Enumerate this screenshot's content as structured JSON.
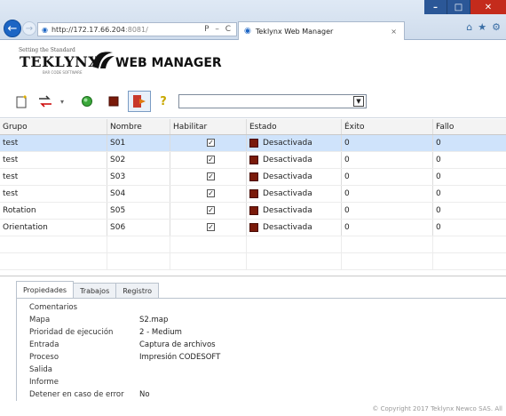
{
  "browser": {
    "address_host": "http://172.17.66.204",
    "address_path": ":8081/",
    "address_tools": "Ρ – C",
    "tab_title": "Teklynx Web Manager",
    "tab_close": "×"
  },
  "logo": {
    "tagline": "Setting the Standard",
    "brand": "TEKLYNX",
    "sub": "BAR CODE SOFTWARE",
    "product": "WEB MANAGER"
  },
  "toolbar": {
    "help": "?",
    "dropdown_arrow": "▾"
  },
  "grid": {
    "headers": [
      "Grupo",
      "Nombre",
      "Habilitar",
      "Estado",
      "Éxito",
      "Fallo"
    ],
    "rows": [
      {
        "grupo": "test",
        "nombre": "S01",
        "habilitar": "✓",
        "estado": "Desactivada",
        "exito": "0",
        "fallo": "0"
      },
      {
        "grupo": "test",
        "nombre": "S02",
        "habilitar": "✓",
        "estado": "Desactivada",
        "exito": "0",
        "fallo": "0"
      },
      {
        "grupo": "test",
        "nombre": "S03",
        "habilitar": "✓",
        "estado": "Desactivada",
        "exito": "0",
        "fallo": "0"
      },
      {
        "grupo": "test",
        "nombre": "S04",
        "habilitar": "✓",
        "estado": "Desactivada",
        "exito": "0",
        "fallo": "0"
      },
      {
        "grupo": "Rotation",
        "nombre": "S05",
        "habilitar": "✓",
        "estado": "Desactivada",
        "exito": "0",
        "fallo": "0"
      },
      {
        "grupo": "Orientation",
        "nombre": "S06",
        "habilitar": "✓",
        "estado": "Desactivada",
        "exito": "0",
        "fallo": "0"
      }
    ]
  },
  "panel": {
    "tabs": [
      "Propiedades",
      "Trabajos",
      "Registro"
    ],
    "properties": [
      {
        "label": "Comentarios",
        "value": ""
      },
      {
        "label": "Mapa",
        "value": "S2.map"
      },
      {
        "label": "Prioridad de ejecución",
        "value": "2 - Medium"
      },
      {
        "label": "Entrada",
        "value": "Captura de archivos"
      },
      {
        "label": "Proceso",
        "value": "Impresión CODESOFT"
      },
      {
        "label": "Salida",
        "value": ""
      },
      {
        "label": "Informe",
        "value": ""
      },
      {
        "label": "Detener en caso de error",
        "value": "No"
      }
    ]
  },
  "footer": "© Copyright 2017 Teklynx Newco SAS. All",
  "colors": {
    "selected_row": "#cfe3fb",
    "state_swatch": "#7a1a0a",
    "window_close": "#c42b1c"
  }
}
